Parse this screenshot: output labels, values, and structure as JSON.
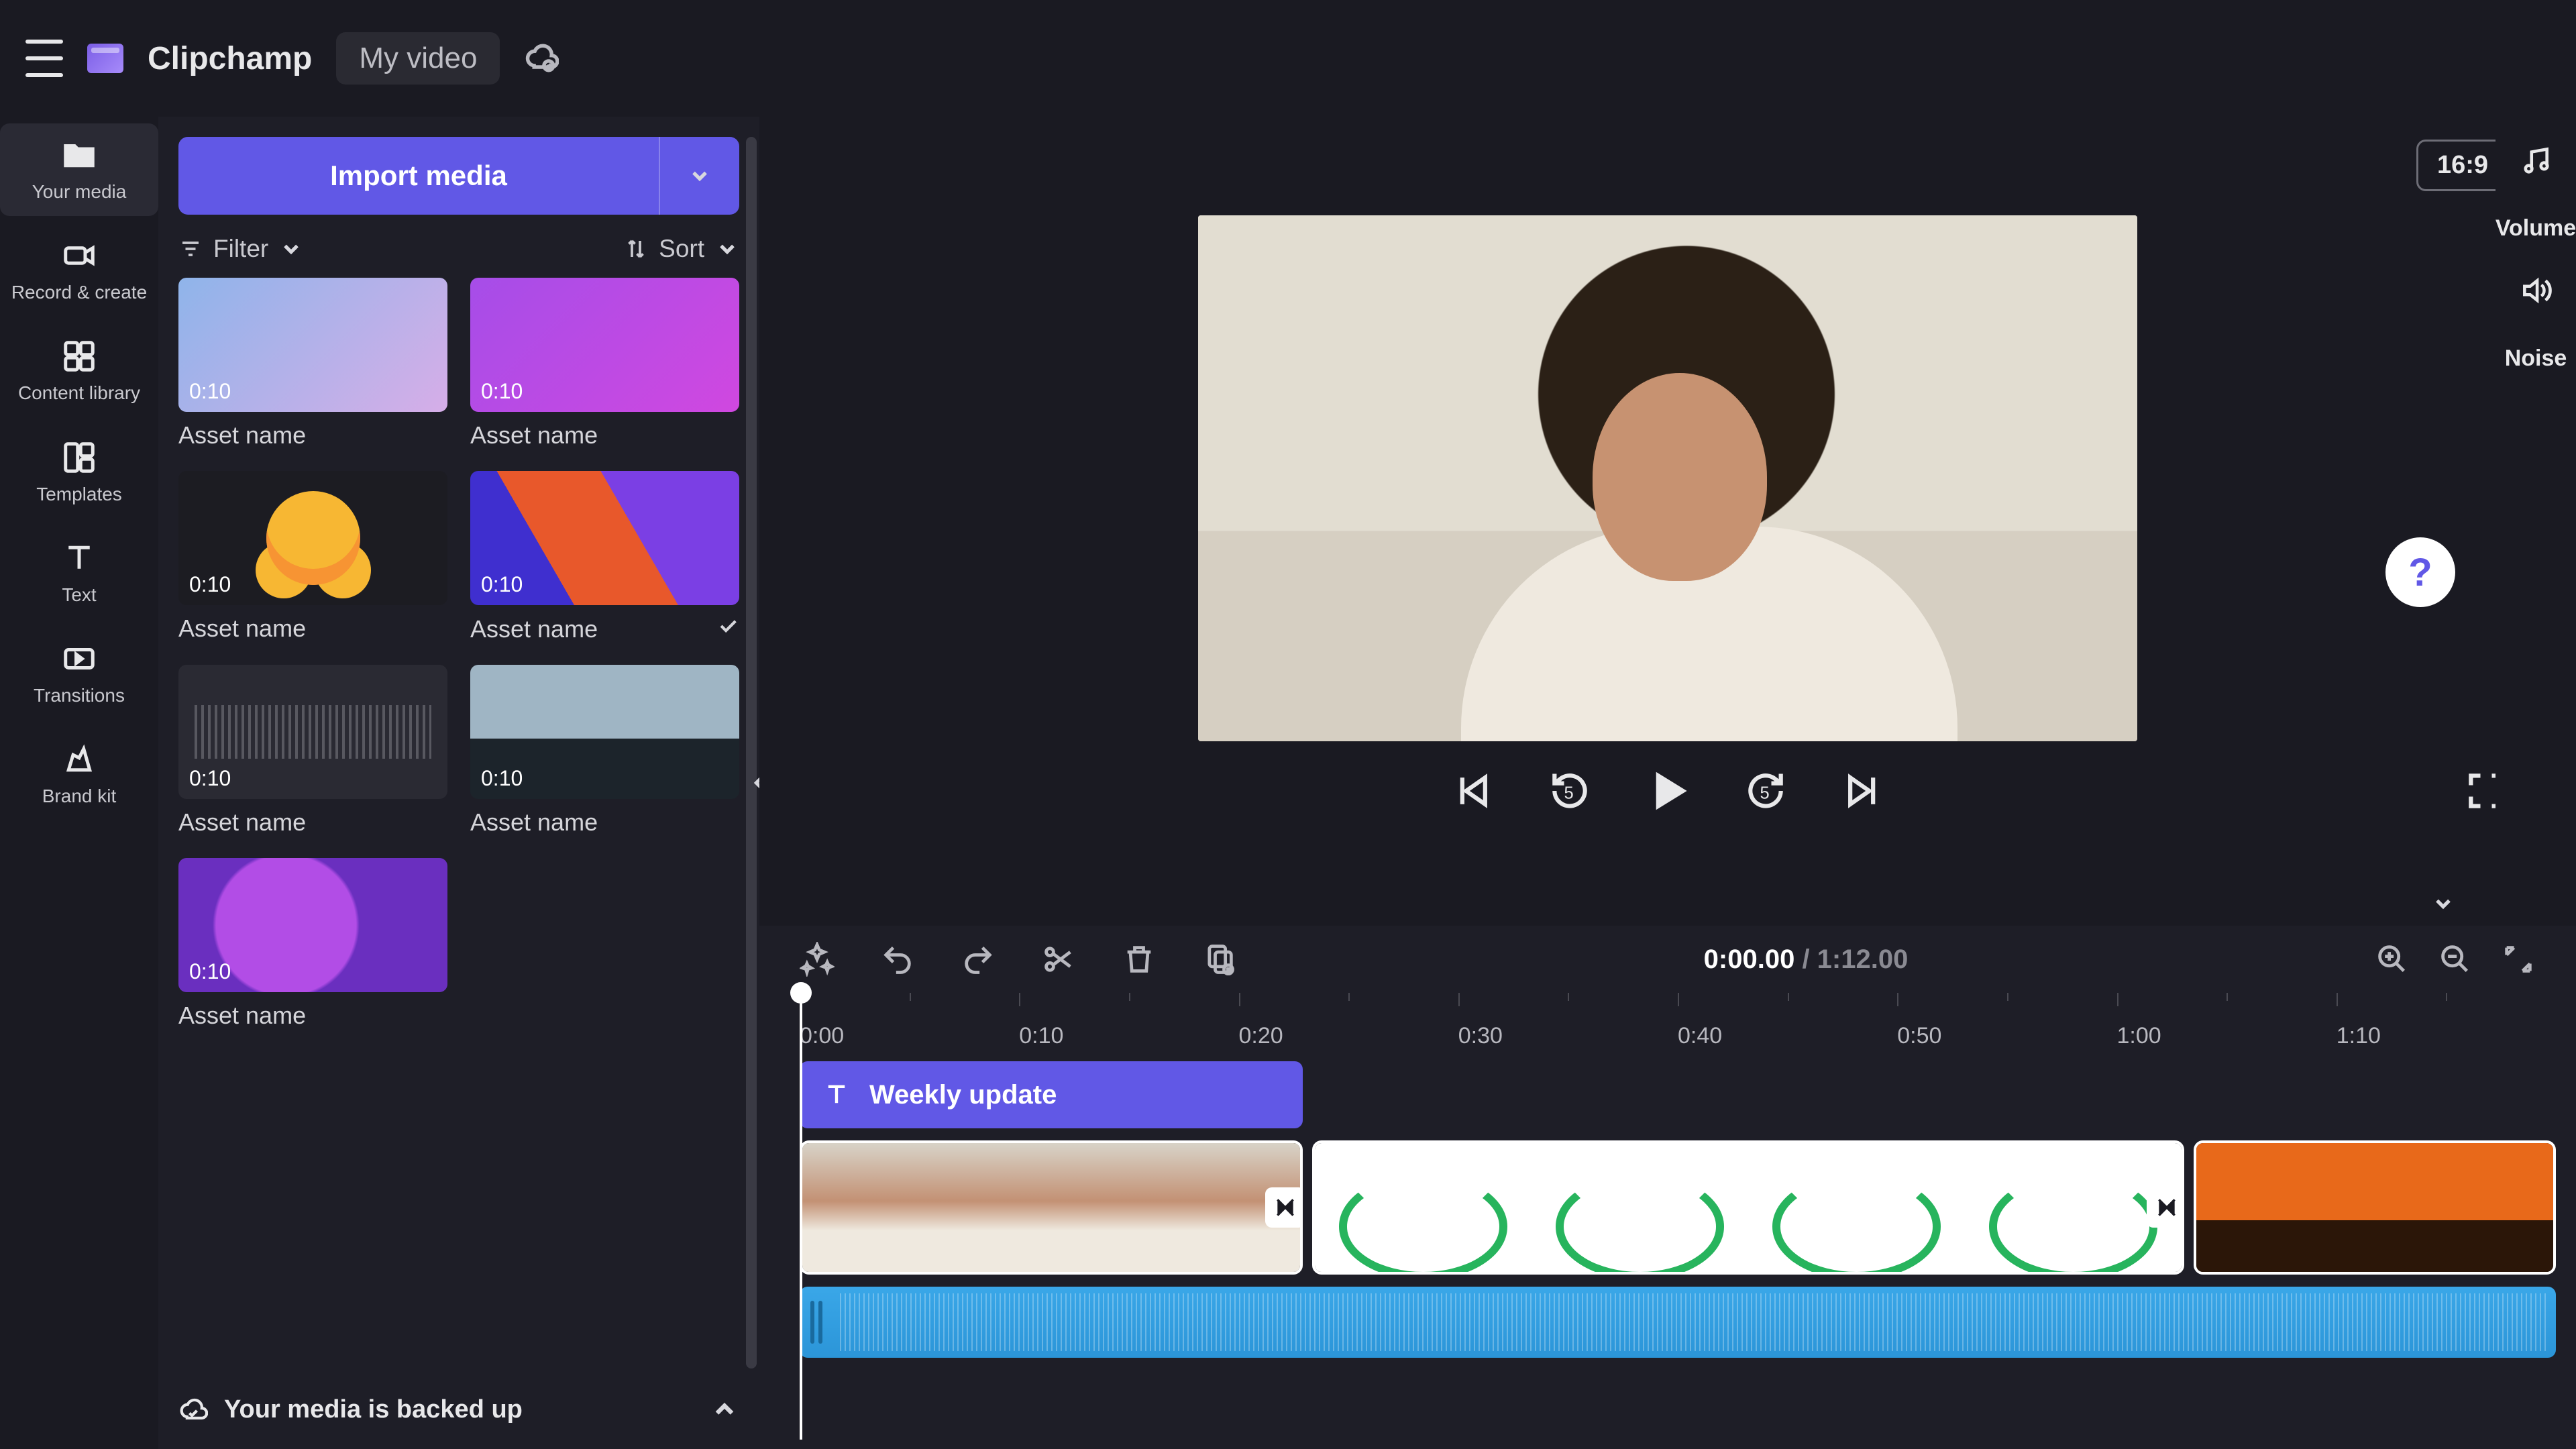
{
  "app": {
    "name": "Clipchamp",
    "project": "My video"
  },
  "leftrail": [
    {
      "label": "Your media",
      "id": "your-media",
      "active": true
    },
    {
      "label": "Record & create",
      "id": "record-create"
    },
    {
      "label": "Content library",
      "id": "content-library"
    },
    {
      "label": "Templates",
      "id": "templates"
    },
    {
      "label": "Text",
      "id": "text"
    },
    {
      "label": "Transitions",
      "id": "transitions"
    },
    {
      "label": "Brand kit",
      "id": "brand-kit"
    }
  ],
  "mediaPanel": {
    "import": "Import media",
    "filter": "Filter",
    "sort": "Sort",
    "assets": [
      {
        "duration": "0:10",
        "name": "Asset name",
        "thumb": "at1"
      },
      {
        "duration": "0:10",
        "name": "Asset name",
        "thumb": "at2"
      },
      {
        "duration": "0:10",
        "name": "Asset name",
        "thumb": "at3"
      },
      {
        "duration": "0:10",
        "name": "Asset name",
        "thumb": "at4",
        "checked": true
      },
      {
        "duration": "0:10",
        "name": "Asset name",
        "thumb": "at5"
      },
      {
        "duration": "0:10",
        "name": "Asset name",
        "thumb": "at6"
      },
      {
        "duration": "0:10",
        "name": "Asset name",
        "thumb": "at7"
      }
    ],
    "backup": "Your media is backed up"
  },
  "preview": {
    "aspect": "16:9"
  },
  "rightPanel": {
    "volume": "Volume",
    "noise": "Noise"
  },
  "timeline": {
    "current": "0:00.00",
    "total": "1:12.00",
    "ruler": [
      "0:00",
      "0:10",
      "0:20",
      "0:30",
      "0:40",
      "0:50",
      "1:00",
      "1:10"
    ],
    "textClip": "Weekly update"
  }
}
